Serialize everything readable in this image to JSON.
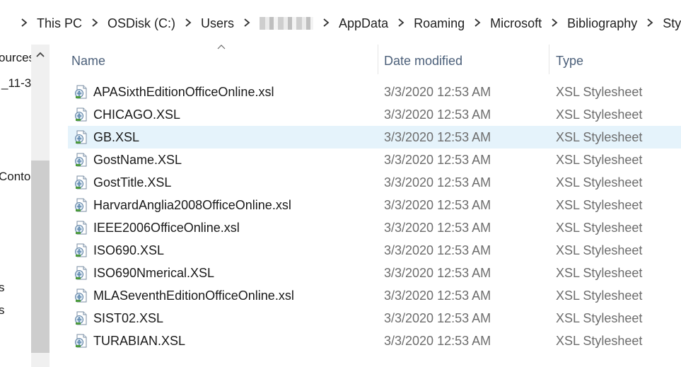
{
  "breadcrumb": {
    "items": [
      "This PC",
      "OSDisk (C:)",
      "Users",
      "",
      "AppData",
      "Roaming",
      "Microsoft",
      "Bibliography",
      "Style"
    ]
  },
  "nav": {
    "items": [
      "ources",
      "_11-3",
      "Contos",
      "s",
      "s"
    ]
  },
  "columns": {
    "name": "Name",
    "date": "Date modified",
    "type": "Type"
  },
  "files": [
    {
      "name": "APASixthEditionOfficeOnline.xsl",
      "date": "3/3/2020 12:53 AM",
      "type": "XSL Stylesheet"
    },
    {
      "name": "CHICAGO.XSL",
      "date": "3/3/2020 12:53 AM",
      "type": "XSL Stylesheet"
    },
    {
      "name": "GB.XSL",
      "date": "3/3/2020 12:53 AM",
      "type": "XSL Stylesheet"
    },
    {
      "name": "GostName.XSL",
      "date": "3/3/2020 12:53 AM",
      "type": "XSL Stylesheet"
    },
    {
      "name": "GostTitle.XSL",
      "date": "3/3/2020 12:53 AM",
      "type": "XSL Stylesheet"
    },
    {
      "name": "HarvardAnglia2008OfficeOnline.xsl",
      "date": "3/3/2020 12:53 AM",
      "type": "XSL Stylesheet"
    },
    {
      "name": "IEEE2006OfficeOnline.xsl",
      "date": "3/3/2020 12:53 AM",
      "type": "XSL Stylesheet"
    },
    {
      "name": "ISO690.XSL",
      "date": "3/3/2020 12:53 AM",
      "type": "XSL Stylesheet"
    },
    {
      "name": "ISO690Nmerical.XSL",
      "date": "3/3/2020 12:53 AM",
      "type": "XSL Stylesheet"
    },
    {
      "name": "MLASeventhEditionOfficeOnline.xsl",
      "date": "3/3/2020 12:53 AM",
      "type": "XSL Stylesheet"
    },
    {
      "name": "SIST02.XSL",
      "date": "3/3/2020 12:53 AM",
      "type": "XSL Stylesheet"
    },
    {
      "name": "TURABIAN.XSL",
      "date": "3/3/2020 12:53 AM",
      "type": "XSL Stylesheet"
    }
  ],
  "selected_file": "GB.XSL",
  "colors": {
    "selection": "#e5f3fb",
    "header_text": "#4c607a",
    "secondary_text": "#6d6d6d",
    "folder": "#f3c043"
  },
  "icons": {
    "folder": "folder-icon",
    "separator": "chevron-right-icon",
    "file": "xsl-file-icon",
    "sort": "sort-up-icon",
    "scroll_up": "chevron-up-icon"
  }
}
